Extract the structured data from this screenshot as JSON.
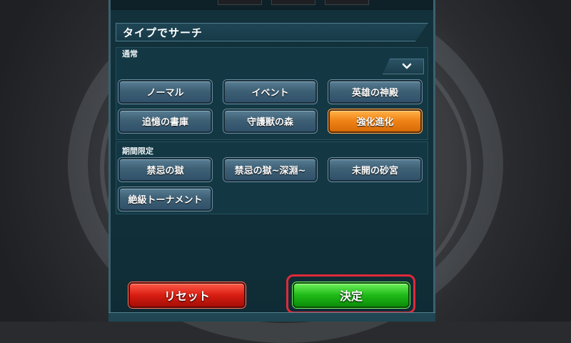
{
  "header": {
    "title": "タイプでサーチ"
  },
  "sections": [
    {
      "label": "通常",
      "buttons": [
        {
          "label": "ノーマル",
          "active": false
        },
        {
          "label": "イベント",
          "active": false
        },
        {
          "label": "英雄の神殿",
          "active": false
        },
        {
          "label": "追憶の書庫",
          "active": false
        },
        {
          "label": "守護獣の森",
          "active": false
        },
        {
          "label": "強化進化",
          "active": true
        }
      ]
    },
    {
      "label": "期間限定",
      "buttons": [
        {
          "label": "禁忌の獄",
          "active": false
        },
        {
          "label": "禁忌の獄~深淵~",
          "active": false
        },
        {
          "label": "未開の砂宮",
          "active": false
        },
        {
          "label": "絶級トーナメント",
          "active": false
        }
      ]
    }
  ],
  "footer": {
    "reset_label": "リセット",
    "confirm_label": "決定"
  },
  "colors": {
    "panel": "#13313b",
    "button": "#3e6075",
    "active": "#f08518",
    "reset": "#d81e12",
    "confirm": "#1fba18",
    "highlight": "#e0293a"
  },
  "icons": {
    "dropdown": "chevron-down-icon"
  }
}
